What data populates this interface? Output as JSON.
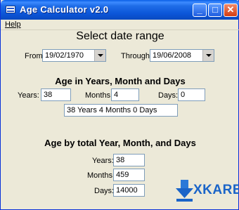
{
  "window": {
    "title": "Age Calculator v2.0",
    "minimize": "_",
    "maximize": "□",
    "close": "✕"
  },
  "menu": {
    "help": "Help"
  },
  "range": {
    "heading": "Select date range",
    "from_label": "From:",
    "from_value": "19/02/1970",
    "through_label": "Through:",
    "through_value": "19/06/2008"
  },
  "age": {
    "heading": "Age in Years, Month and Days",
    "years_label": "Years:",
    "years_value": "38",
    "months_label": "Months:",
    "months_value": "4",
    "days_label": "Days:",
    "days_value": "0",
    "summary": "38 Years 4 Months 0 Days"
  },
  "total": {
    "heading": "Age by total Year, Month, and Days",
    "years_label": "Years:",
    "years_value": "38",
    "months_label": "Months:",
    "months_value": "459",
    "days_label": "Days:",
    "days_value": "14000"
  },
  "logo": {
    "text": "XKARE",
    "color": "#1a64c8"
  },
  "colors": {
    "titlebar": "#0b55d8",
    "face": "#ece9d8",
    "field_border": "#7f9db9"
  },
  "icons": [
    "app-icon",
    "minimize-icon",
    "maximize-icon",
    "close-icon",
    "dropdown-arrow-icon",
    "download-arrow-icon"
  ]
}
